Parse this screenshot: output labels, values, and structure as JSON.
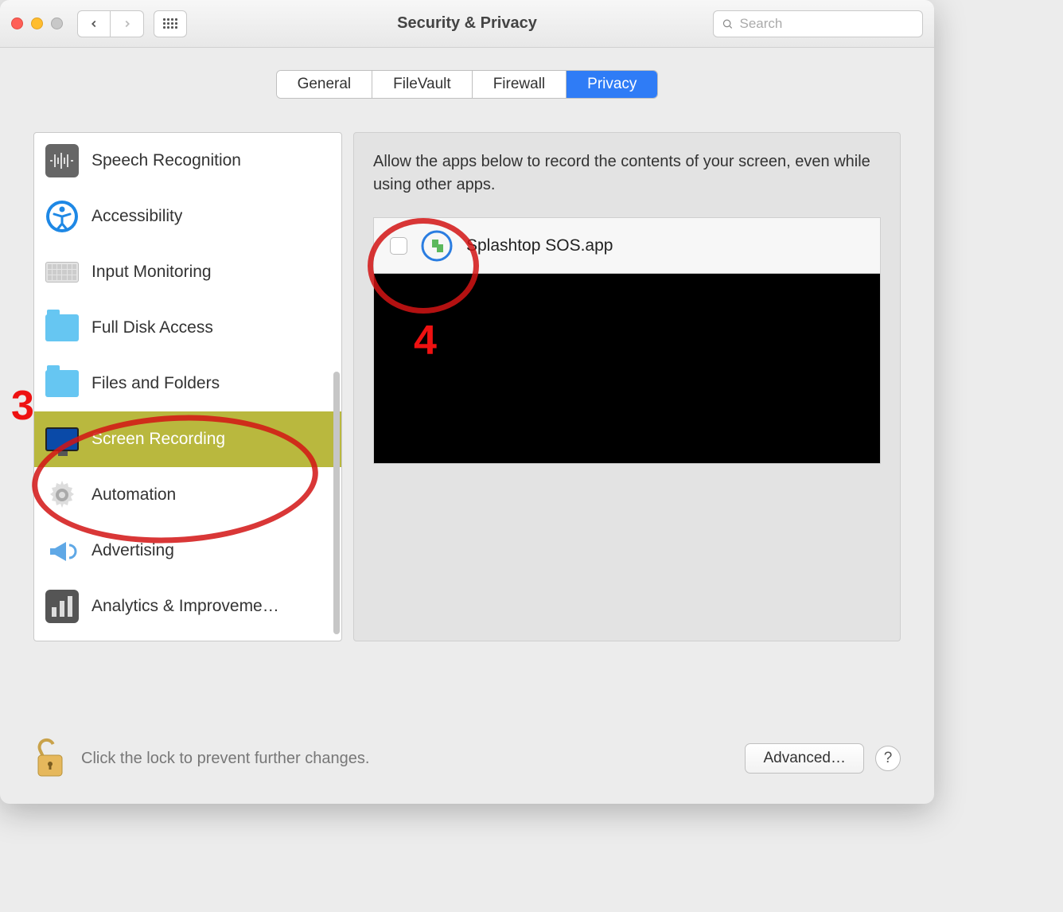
{
  "titlebar": {
    "title": "Security & Privacy",
    "search_placeholder": "Search"
  },
  "tabs": [
    {
      "label": "General",
      "active": false
    },
    {
      "label": "FileVault",
      "active": false
    },
    {
      "label": "Firewall",
      "active": false
    },
    {
      "label": "Privacy",
      "active": true
    }
  ],
  "sidebar": {
    "items": [
      {
        "label": "Speech Recognition",
        "icon": "waveform"
      },
      {
        "label": "Accessibility",
        "icon": "accessibility"
      },
      {
        "label": "Input Monitoring",
        "icon": "keyboard"
      },
      {
        "label": "Full Disk Access",
        "icon": "folder"
      },
      {
        "label": "Files and Folders",
        "icon": "folder"
      },
      {
        "label": "Screen Recording",
        "icon": "monitor",
        "selected": true
      },
      {
        "label": "Automation",
        "icon": "gear"
      },
      {
        "label": "Advertising",
        "icon": "megaphone"
      },
      {
        "label": "Analytics & Improveme…",
        "icon": "bars"
      }
    ]
  },
  "right_panel": {
    "description": "Allow the apps below to record the contents of your screen, even while using other apps.",
    "apps": [
      {
        "name": "Splashtop SOS.app",
        "checked": false
      }
    ]
  },
  "bottom": {
    "lock_text": "Click the lock to prevent further changes.",
    "advanced_label": "Advanced…",
    "help_label": "?"
  },
  "annotations": {
    "label3": "3",
    "label4": "4"
  }
}
